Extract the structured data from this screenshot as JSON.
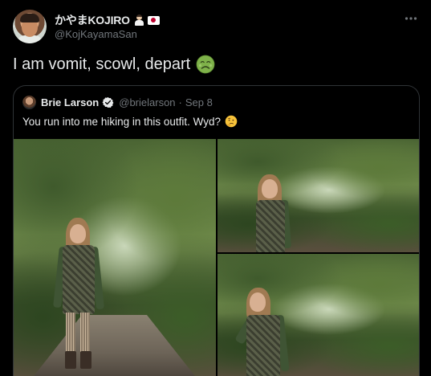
{
  "author": {
    "display_name": "かやまKOJIRO",
    "handle": "@KojKayamaSan"
  },
  "tweet": {
    "text": "I am vomit, scowl, depart"
  },
  "quoted": {
    "display_name": "Brie Larson",
    "handle": "@brielarson",
    "separator": "·",
    "date": "Sep 8",
    "text": "You run into me hiking in this outfit. Wyd?"
  },
  "icons": {
    "more": "more-options-icon",
    "verified": "verified-badge-icon",
    "sick_emoji": "nauseated-face-emoji",
    "thinking_emoji": "thinking-face-emoji",
    "flag_emoji": "japan-flag-emoji",
    "person_emoji": "chef-emoji"
  },
  "colors": {
    "background": "#000000",
    "text": "#e7e9ea",
    "muted": "#71767b",
    "border": "#2f3336",
    "verified": "#e7e9ea"
  }
}
